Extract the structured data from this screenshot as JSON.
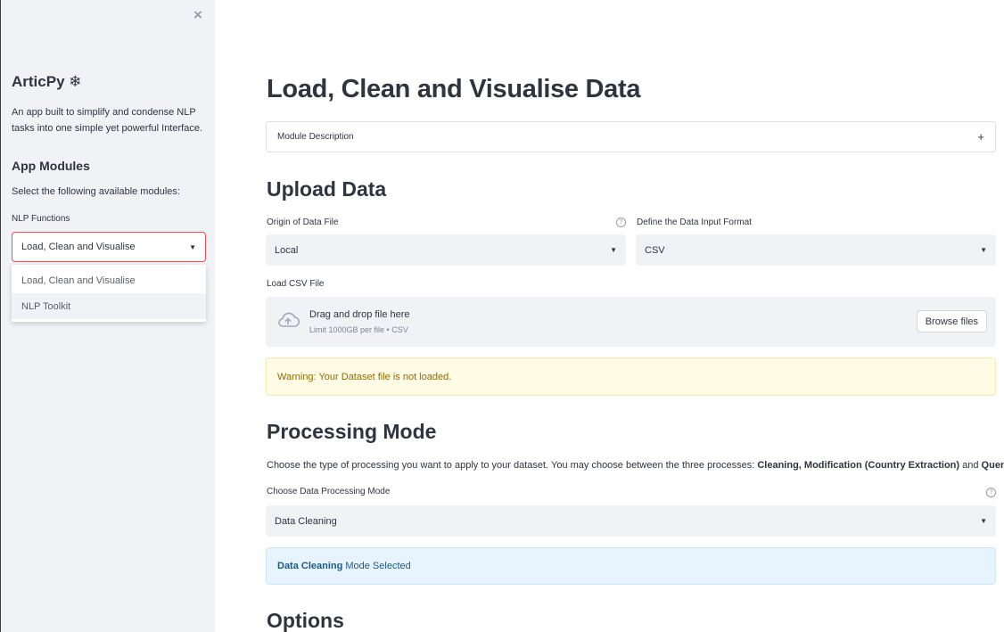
{
  "sidebar": {
    "close_symbol": "×",
    "app_title": "ArticPy ❄",
    "app_description": "An app built to simplify and condense NLP tasks into one simple yet powerful Interface.",
    "modules_title": "App Modules",
    "modules_subtitle": "Select the following available modules:",
    "nlp_label": "NLP Functions",
    "nlp_selected": "Load, Clean and Visualise",
    "nlp_options": [
      "Load, Clean and Visualise",
      "NLP Toolkit"
    ]
  },
  "main": {
    "title": "Load, Clean and Visualise Data",
    "expander_label": "Module Description",
    "expander_symbol": "+",
    "upload": {
      "heading": "Upload Data",
      "origin_label": "Origin of Data File",
      "origin_value": "Local",
      "format_label": "Define the Data Input Format",
      "format_value": "CSV",
      "file_label": "Load CSV File",
      "drop_title": "Drag and drop file here",
      "drop_sub": "Limit 1000GB per file • CSV",
      "browse_label": "Browse files"
    },
    "warning_text": "Warning: Your Dataset file is not loaded.",
    "processing": {
      "heading": "Processing Mode",
      "desc_prefix": "Choose the type of processing you want to apply to your dataset. You may choose between the three processes: ",
      "desc_bold1": "Cleaning, Modification (Country Extraction)",
      "desc_mid": " and ",
      "desc_bold2": "Query.",
      "mode_label": "Choose Data Processing Mode",
      "mode_value": "Data Cleaning",
      "info_bold": "Data Cleaning",
      "info_text": "Mode Selected"
    },
    "options_heading": "Options"
  },
  "help_symbol": "?",
  "caret_symbol": "▼",
  "colors": {
    "accent": "#ff4b4b",
    "sidebar_bg": "#f0f2f6",
    "warning_bg": "#fffbe5",
    "info_bg": "#e8f4fd"
  }
}
